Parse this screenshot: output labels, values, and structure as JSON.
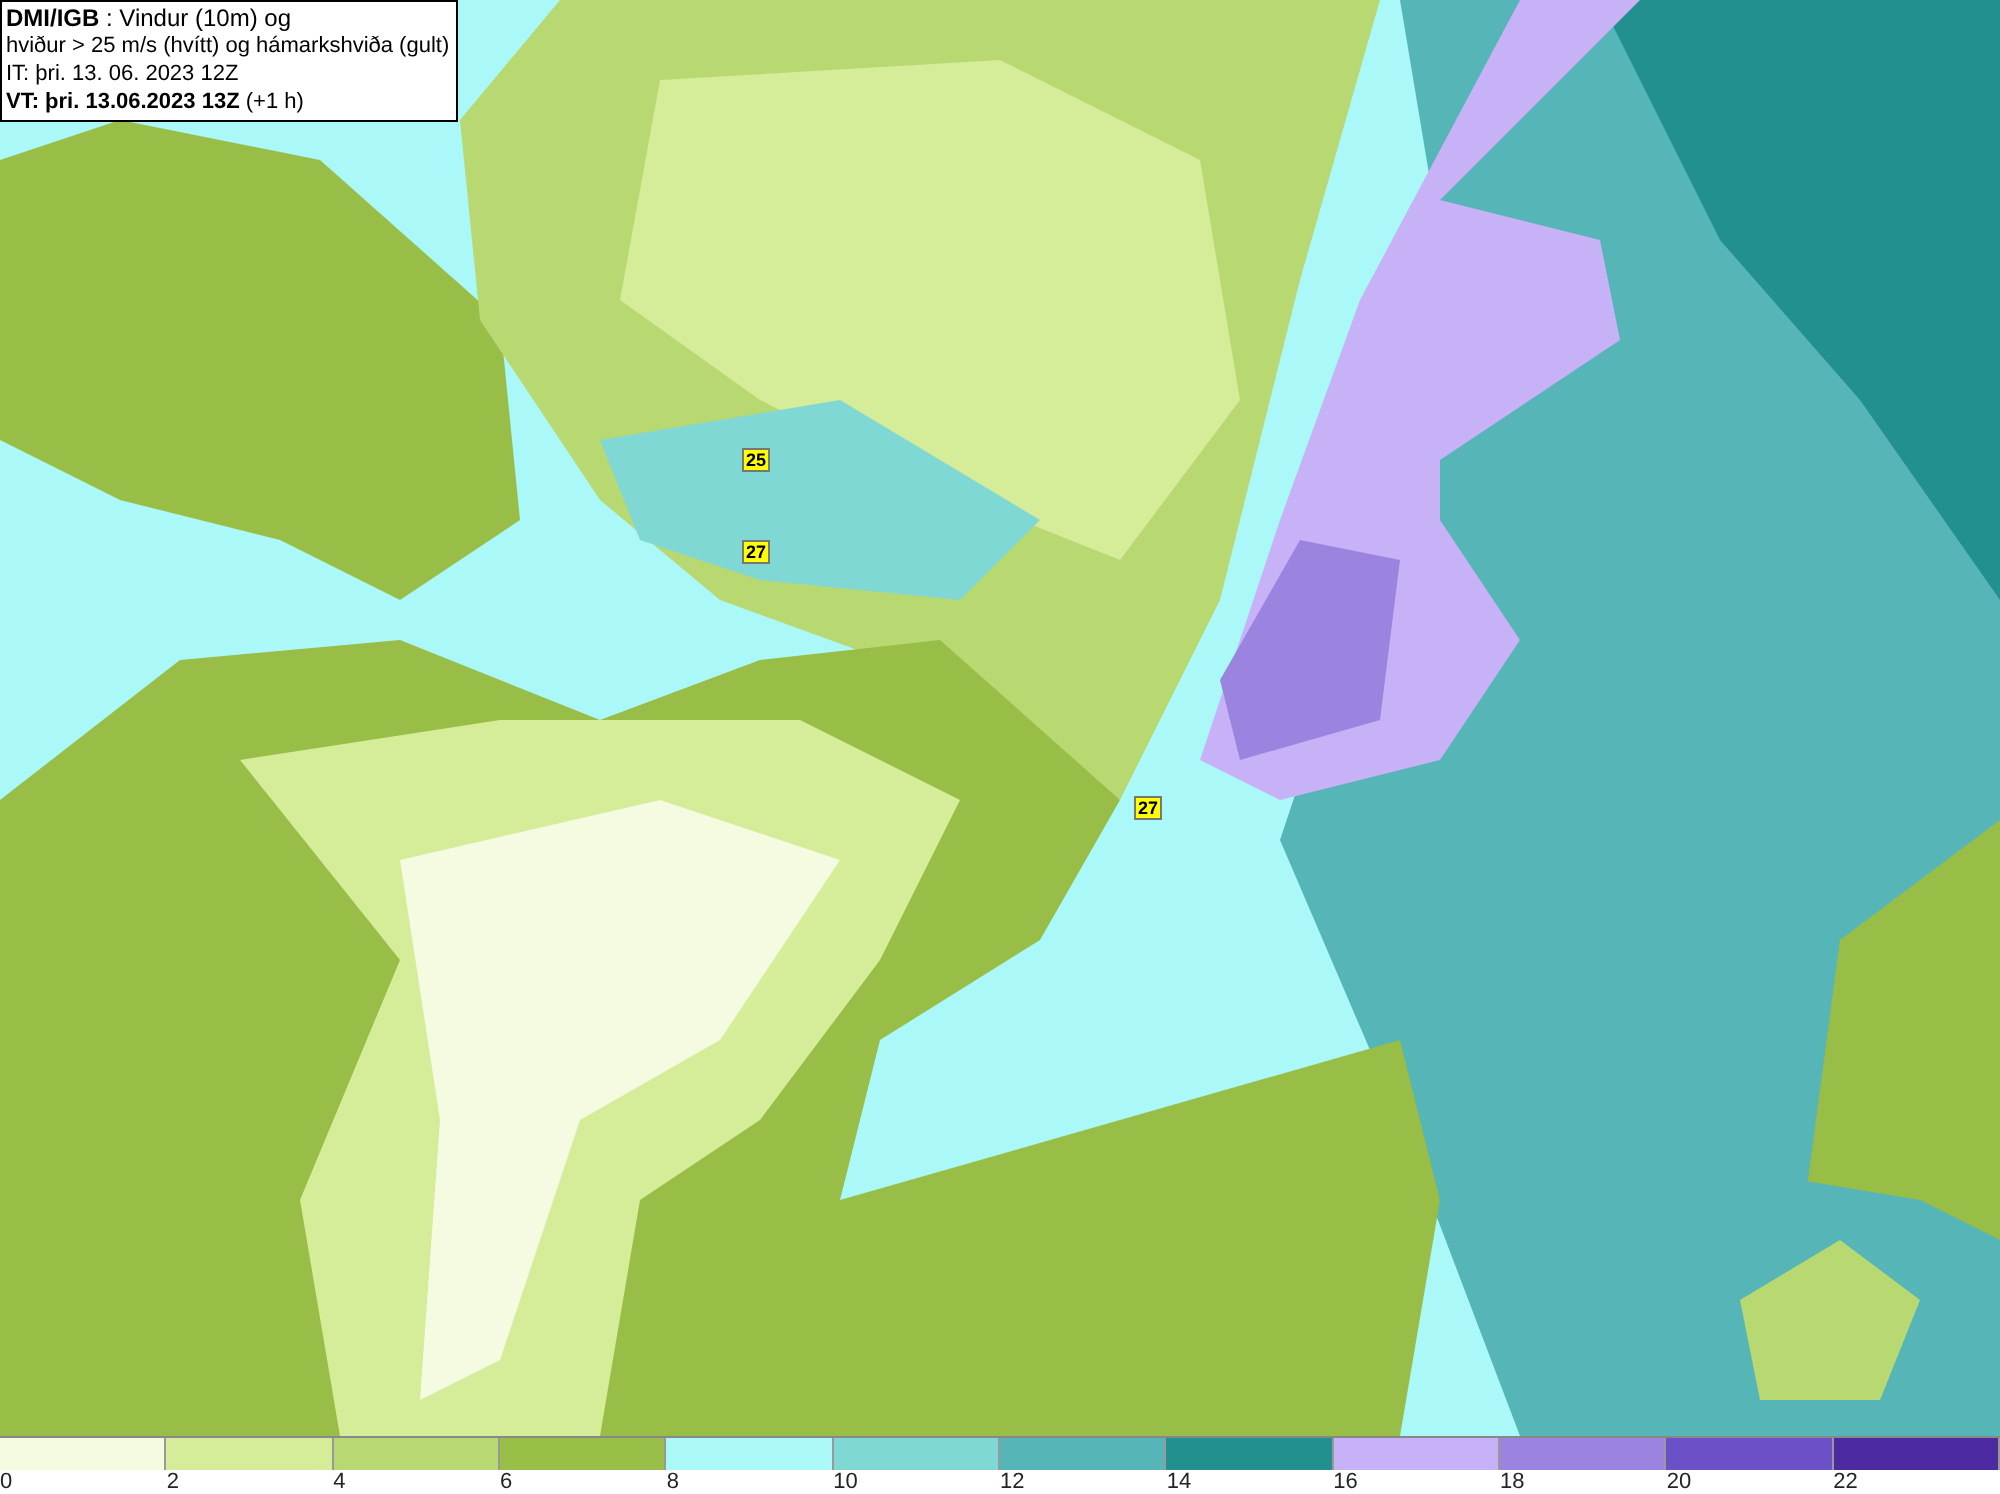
{
  "header": {
    "lines": [
      "**DMI/IGB** : Vindur (10m) og",
      "hviður > 25 m/s (hvítt) og hámarkshviða (gult)",
      "IT: þri. 13. 06. 2023 12Z",
      "**VT: þri. 13.06.2023 13Z** (+1 h)"
    ]
  },
  "map": {
    "gust_labels": [
      {
        "text": "25"
      },
      {
        "text": "27"
      },
      {
        "text": "27"
      }
    ]
  },
  "legend": {
    "items": [
      {
        "label": "0",
        "color": "#f4fbe1"
      },
      {
        "label": "2",
        "color": "#d5ec98"
      },
      {
        "label": "4",
        "color": "#b8d872"
      },
      {
        "label": "6",
        "color": "#98be48"
      },
      {
        "label": "8",
        "color": "#aaf9f8"
      },
      {
        "label": "10",
        "color": "#80d8d5"
      },
      {
        "label": "12",
        "color": "#56b5b6"
      },
      {
        "label": "14",
        "color": "#239090"
      },
      {
        "label": "16",
        "color": "#c7b2f8"
      },
      {
        "label": "18",
        "color": "#9b84e0"
      },
      {
        "label": "20",
        "color": "#6c50c8"
      },
      {
        "label": "22",
        "color": "#4b2b9f"
      }
    ]
  }
}
